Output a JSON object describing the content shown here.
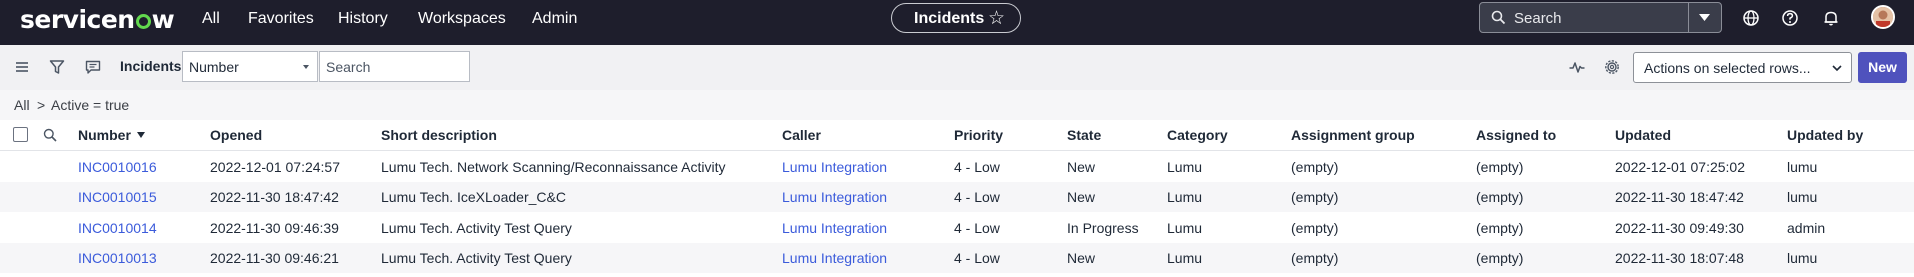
{
  "app": {
    "logo": "servicenow",
    "nav": [
      "All",
      "Favorites",
      "History",
      "Workspaces",
      "Admin"
    ],
    "context_pill": "Incidents",
    "search_placeholder": "Search"
  },
  "toolbar": {
    "title": "Incidents",
    "field_select": "Number",
    "search_placeholder": "Search",
    "actions_select": "Actions on selected rows...",
    "new_label": "New"
  },
  "breadcrumb": [
    "All",
    ">",
    "Active = true"
  ],
  "table": {
    "columns": [
      "Number",
      "Opened",
      "Short description",
      "Caller",
      "Priority",
      "State",
      "Category",
      "Assignment group",
      "Assigned to",
      "Updated",
      "Updated by"
    ],
    "rows": [
      [
        "INC0010016",
        "2022-12-01 07:24:57",
        "Lumu Tech. Network Scanning/Reconnaissance Activity",
        "Lumu Integration",
        "4 - Low",
        "New",
        "Lumu",
        "(empty)",
        "(empty)",
        "2022-12-01 07:25:02",
        "lumu"
      ],
      [
        "INC0010015",
        "2022-11-30 18:47:42",
        "Lumu Tech. IceXLoader_C&C",
        "Lumu Integration",
        "4 - Low",
        "New",
        "Lumu",
        "(empty)",
        "(empty)",
        "2022-11-30 18:47:42",
        "lumu"
      ],
      [
        "INC0010014",
        "2022-11-30 09:46:39",
        "Lumu Tech. Activity Test Query",
        "Lumu Integration",
        "4 - Low",
        "In Progress",
        "Lumu",
        "(empty)",
        "(empty)",
        "2022-11-30 09:49:30",
        "admin"
      ],
      [
        "INC0010013",
        "2022-11-30 09:46:21",
        "Lumu Tech. Activity Test Query",
        "Lumu Integration",
        "4 - Low",
        "New",
        "Lumu",
        "(empty)",
        "(empty)",
        "2022-11-30 18:07:48",
        "lumu"
      ]
    ]
  },
  "colors": {
    "topbar": "#1e1e2c",
    "accent": "#4f52bd",
    "link": "#3b5bdb",
    "logo_o": "#62d84e"
  }
}
